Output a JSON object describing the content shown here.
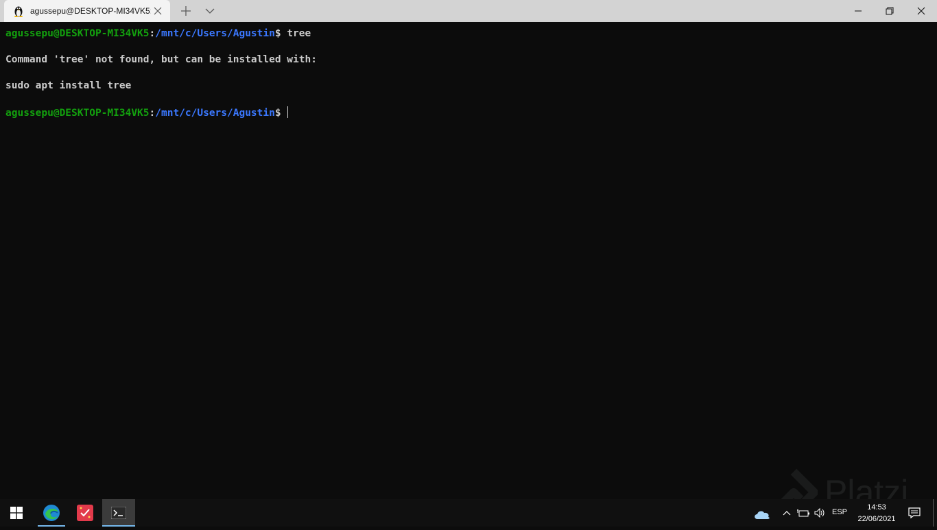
{
  "window": {
    "tab_title": "agussepu@DESKTOP-MI34VK5:",
    "tab_icon": "linux-penguin-icon"
  },
  "terminal": {
    "lines": [
      {
        "user": "agussepu@DESKTOP-MI34VK5",
        "sep": ":",
        "path": "/mnt/c/Users/Agustin",
        "prompt": "$ ",
        "command": "tree"
      },
      {
        "text": "Command 'tree' not found, but can be installed with:"
      },
      {
        "text": "sudo apt install tree"
      },
      {
        "user": "agussepu@DESKTOP-MI34VK5",
        "sep": ":",
        "path": "/mnt/c/Users/Agustin",
        "prompt": "$",
        "command": ""
      }
    ],
    "colors": {
      "user": "#13a10e",
      "path": "#3b78ff",
      "text": "#cccccc",
      "background": "#0c0c0c"
    }
  },
  "taskbar": {
    "apps": [
      "start-icon",
      "edge-icon",
      "microsoft-todo-icon",
      "windows-terminal-icon"
    ],
    "language": "ESP",
    "time": "14:53",
    "date": "22/06/2021"
  },
  "watermark": {
    "text": "Platzi"
  }
}
